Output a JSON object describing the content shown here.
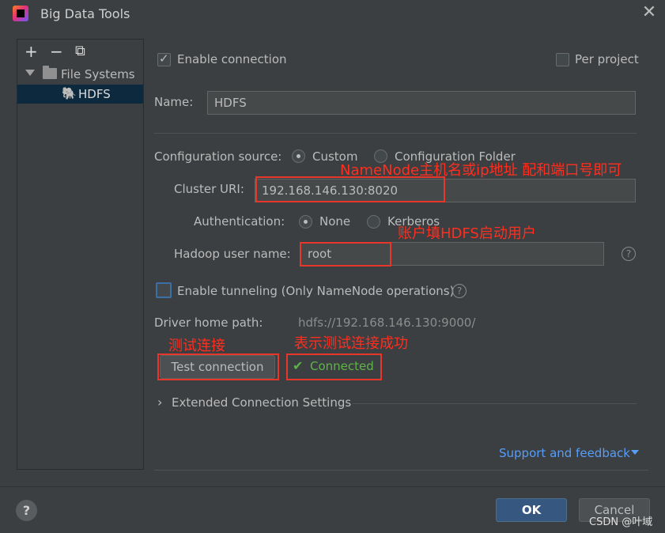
{
  "window": {
    "title": "Big Data Tools",
    "close": "✕"
  },
  "toolbar": {
    "add": "+",
    "remove": "−",
    "copy": "⧉"
  },
  "tree": {
    "parent": "File Systems",
    "child": "HDFS"
  },
  "form": {
    "enable_connection": "Enable connection",
    "per_project": "Per project",
    "name_label": "Name:",
    "name_value": "HDFS",
    "config_source_label": "Configuration source:",
    "config_custom": "Custom",
    "config_folder": "Configuration Folder",
    "cluster_uri_label": "Cluster URI:",
    "cluster_uri_value": "192.168.146.130:8020",
    "auth_label": "Authentication:",
    "auth_none": "None",
    "auth_kerberos": "Kerberos",
    "hadoop_user_label": "Hadoop user name:",
    "hadoop_user_value": "root",
    "enable_tunneling": "Enable tunneling (Only NameNode operations)",
    "driver_home_label": "Driver home path:",
    "driver_home_value": "hdfs://192.168.146.130:9000/",
    "test_connection": "Test connection",
    "connected": "Connected",
    "extended_settings": "Extended Connection Settings",
    "support_feedback": "Support and feedback"
  },
  "annotations": {
    "namenode": "NameNode主机名或ip地址 配和端口号即可",
    "account": "账户填HDFS启动用户",
    "test": "测试连接",
    "success": "表示测试连接成功"
  },
  "buttons": {
    "ok": "OK",
    "cancel": "Cancel",
    "help": "?"
  },
  "watermark": "CSDN @叶域",
  "colors": {
    "background": "#3c3f41",
    "accent": "#365880",
    "annotation": "#e8362b",
    "success": "#5fb34a",
    "link": "#589df6"
  }
}
